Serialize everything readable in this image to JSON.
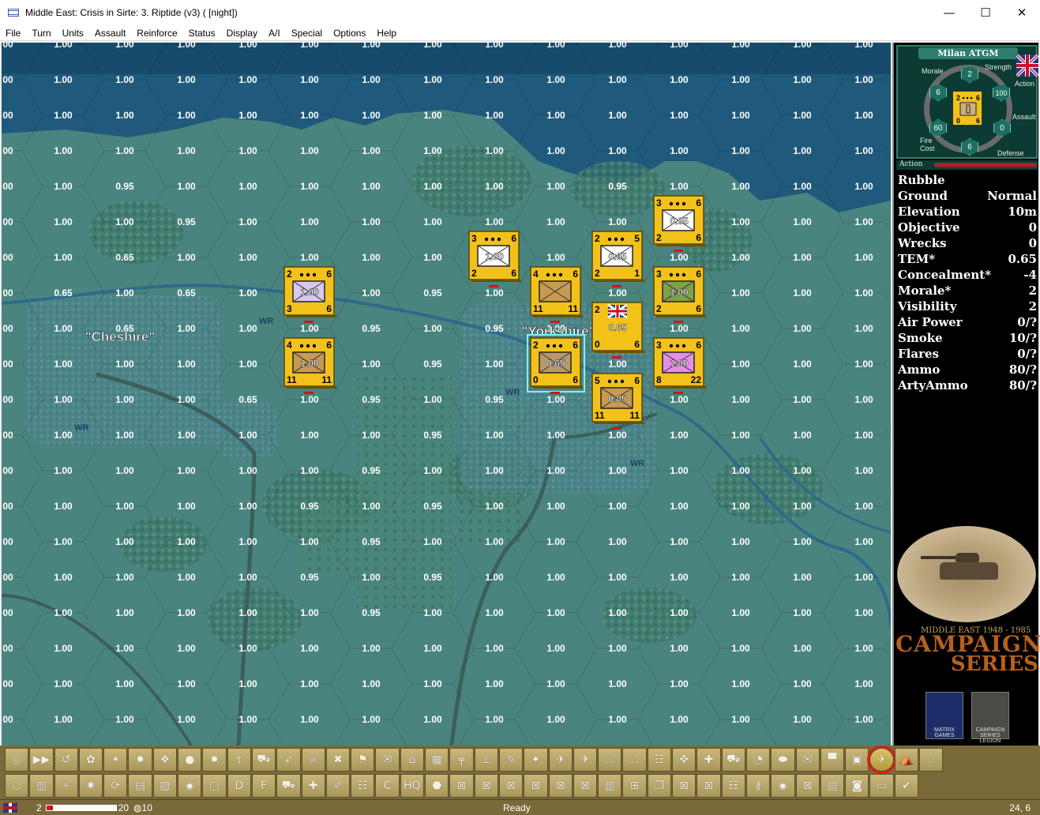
{
  "window": {
    "title": "Middle East: Crisis in Sirte: 3. Riptide (v3) ( [night])",
    "minimize_glyph": "—",
    "maximize_glyph": "☐",
    "close_glyph": "✕"
  },
  "menu": [
    "File",
    "Turn",
    "Units",
    "Assault",
    "Reinforce",
    "Status",
    "Display",
    "A/I",
    "Special",
    "Options",
    "Help"
  ],
  "map": {
    "place_names": [
      {
        "id": "cheshire",
        "label": "\"Cheshire\""
      },
      {
        "id": "yorkshire",
        "label": "\"Yorkshire\""
      }
    ],
    "wr_label": "WR",
    "columns": 15,
    "rows": 20,
    "hex_values": [
      [
        "00",
        "1.00",
        "1.00",
        "1.00",
        "1.00",
        "1.00",
        "1.00",
        "1.00",
        "1.00",
        "1.00",
        "1.00",
        "1.00",
        "1.00",
        "1.00",
        "1.00"
      ],
      [
        "00",
        "1.00",
        "1.00",
        "1.00",
        "1.00",
        "1.00",
        "1.00",
        "1.00",
        "1.00",
        "1.00",
        "1.00",
        "1.00",
        "1.00",
        "1.00",
        "1.00"
      ],
      [
        "00",
        "1.00",
        "1.00",
        "1.00",
        "1.00",
        "1.00",
        "1.00",
        "1.00",
        "1.00",
        "1.00",
        "1.00",
        "1.00",
        "1.00",
        "1.00",
        "1.00"
      ],
      [
        "00",
        "1.00",
        "1.00",
        "1.00",
        "1.00",
        "1.00",
        "1.00",
        "1.00",
        "1.00",
        "1.00",
        "1.00",
        "1.00",
        "1.00",
        "1.00",
        "1.00"
      ],
      [
        "00",
        "1.00",
        "0.95",
        "1.00",
        "1.00",
        "1.00",
        "1.00",
        "1.00",
        "1.00",
        "1.00",
        "0.95",
        "1.00",
        "1.00",
        "1.00",
        "1.00"
      ],
      [
        "00",
        "1.00",
        "1.00",
        "0.95",
        "1.00",
        "1.00",
        "1.00",
        "1.00",
        "1.00",
        "1.00",
        "1.00",
        "0.95",
        "1.00",
        "1.00",
        "1.00"
      ],
      [
        "00",
        "1.00",
        "0.65",
        "1.00",
        "1.00",
        "1.00",
        "1.00",
        "1.00",
        "1.00",
        "1.00",
        "0.65",
        "1.00",
        "1.00",
        "1.00",
        "1.00"
      ],
      [
        "00",
        "0.65",
        "1.00",
        "0.65",
        "1.00",
        "1.00",
        "1.00",
        "0.95",
        "1.00",
        "1.00",
        "1.00",
        "1.00",
        "1.00",
        "1.00",
        "1.00"
      ],
      [
        "00",
        "1.00",
        "0.65",
        "1.00",
        "1.00",
        "1.00",
        "0.95",
        "1.00",
        "0.95",
        "1.00",
        "0.65",
        "1.00",
        "1.00",
        "1.00",
        "1.00"
      ],
      [
        "00",
        "1.00",
        "1.00",
        "1.00",
        "1.00",
        "1.00",
        "1.00",
        "0.95",
        "1.00",
        "0.65",
        "1.00",
        "1.00",
        "1.00",
        "1.00",
        "1.00"
      ],
      [
        "00",
        "1.00",
        "1.00",
        "1.00",
        "0.65",
        "1.00",
        "0.95",
        "1.00",
        "0.95",
        "1.00",
        "0.85",
        "1.00",
        "1.00",
        "1.00",
        "1.00"
      ],
      [
        "00",
        "1.00",
        "1.00",
        "1.00",
        "1.00",
        "1.00",
        "1.00",
        "0.95",
        "1.00",
        "1.00",
        "1.00",
        "1.00",
        "1.00",
        "1.00",
        "1.00"
      ],
      [
        "00",
        "1.00",
        "1.00",
        "1.00",
        "1.00",
        "1.00",
        "0.95",
        "1.00",
        "1.00",
        "1.00",
        "1.00",
        "1.00",
        "1.00",
        "1.00",
        "1.00"
      ],
      [
        "00",
        "1.00",
        "1.00",
        "1.00",
        "1.00",
        "0.95",
        "1.00",
        "0.95",
        "1.00",
        "1.00",
        "1.00",
        "1.00",
        "1.00",
        "1.00",
        "1.00"
      ],
      [
        "00",
        "1.00",
        "1.00",
        "1.00",
        "1.00",
        "1.00",
        "0.95",
        "1.00",
        "1.00",
        "1.00",
        "1.00",
        "1.00",
        "1.00",
        "1.00",
        "1.00"
      ],
      [
        "00",
        "1.00",
        "1.00",
        "1.00",
        "1.00",
        "0.95",
        "1.00",
        "0.95",
        "1.00",
        "1.00",
        "1.00",
        "1.00",
        "1.00",
        "1.00",
        "1.00"
      ],
      [
        "00",
        "1.00",
        "1.00",
        "1.00",
        "1.00",
        "1.00",
        "0.95",
        "1.00",
        "1.00",
        "1.00",
        "1.00",
        "1.00",
        "1.00",
        "1.00",
        "1.00"
      ],
      [
        "00",
        "1.00",
        "1.00",
        "1.00",
        "1.00",
        "1.00",
        "1.00",
        "1.00",
        "1.00",
        "1.00",
        "1.00",
        "1.00",
        "1.00",
        "1.00",
        "1.00"
      ],
      [
        "00",
        "1.00",
        "1.00",
        "1.00",
        "1.00",
        "1.00",
        "1.00",
        "1.00",
        "1.00",
        "1.00",
        "1.00",
        "1.00",
        "1.00",
        "1.00",
        "1.00"
      ],
      [
        "00",
        "1.00",
        "1.00",
        "1.00",
        "1.00",
        "1.00",
        "1.00",
        "1.00",
        "1.00",
        "1.00",
        "1.00",
        "1.00",
        "1.00",
        "1.00",
        "1.00"
      ]
    ],
    "units": [
      {
        "col": 5,
        "row": 7,
        "top_left": "2",
        "bottom_left": "3",
        "bottom_right": "6",
        "top_right": "6",
        "value": "1.00",
        "symbol_color": "#d8c8f0"
      },
      {
        "col": 5,
        "row": 9,
        "top_left": "4",
        "bottom_left": "11",
        "bottom_right": "11",
        "top_right": "6",
        "value": "1.00",
        "symbol_color": "#c79a52"
      },
      {
        "col": 8,
        "row": 6,
        "top_left": "3",
        "bottom_left": "2",
        "bottom_right": "6",
        "top_right": "6",
        "value": "1.00",
        "symbol_color": "#ffffff"
      },
      {
        "col": 9,
        "row": 7,
        "top_left": "4",
        "bottom_left": "11",
        "bottom_right": "11",
        "top_right": "6",
        "value": "",
        "symbol_color": "#c79a52"
      },
      {
        "col": 9,
        "row": 9,
        "top_left": "2",
        "bottom_left": "0",
        "bottom_right": "6",
        "top_right": "6",
        "value": "0.65",
        "symbol_color": "#b89a6a",
        "selected": true
      },
      {
        "col": 10,
        "row": 6,
        "top_left": "2",
        "bottom_left": "2",
        "bottom_right": "1",
        "top_right": "5",
        "value": "0.65",
        "symbol_color": "#ffffff"
      },
      {
        "col": 10,
        "row": 8,
        "top_left": "2",
        "bottom_left": "0",
        "bottom_right": "6",
        "top_right": "",
        "value": "0.65",
        "symbol_color": "#f2c21b",
        "flag": true
      },
      {
        "col": 10,
        "row": 10,
        "top_left": "5",
        "bottom_left": "11",
        "bottom_right": "11",
        "top_right": "6",
        "value": "0.85",
        "symbol_color": "#c79a52"
      },
      {
        "col": 11,
        "row": 5,
        "top_left": "3",
        "bottom_left": "2",
        "bottom_right": "6",
        "top_right": "6",
        "value": "0.95",
        "symbol_color": "#ffffff"
      },
      {
        "col": 11,
        "row": 7,
        "top_left": "3",
        "bottom_left": "2",
        "bottom_right": "6",
        "top_right": "6",
        "value": "1.00",
        "symbol_color": "#7fa04a"
      },
      {
        "col": 11,
        "row": 9,
        "top_left": "3",
        "bottom_left": "8",
        "bottom_right": "22",
        "top_right": "6",
        "value": "1.00",
        "symbol_color": "#e48ee8"
      }
    ]
  },
  "unit_card": {
    "name": "Milan ATGM",
    "labels": {
      "morale": "Morale",
      "strength": "Strength",
      "action": "Action",
      "assault": "Assault",
      "fire_cost": "Fire\nCost",
      "defense": "Defense"
    },
    "values": {
      "strength": "2",
      "morale": "6",
      "action": "100",
      "assault": "0",
      "defense": "6",
      "fire_cost": "60"
    },
    "counter": {
      "top_left": "2",
      "top_right": "6",
      "bottom_left": "0",
      "bottom_right": "6"
    },
    "action_label": "Action",
    "action_level": 1.0
  },
  "terrain": {
    "heading": "Rubble",
    "rows": [
      {
        "label": "Ground",
        "value": "Normal"
      },
      {
        "label": "Elevation",
        "value": "10m"
      },
      {
        "label": "Objective",
        "value": "0"
      },
      {
        "label": "Wrecks",
        "value": "0"
      },
      {
        "label": "TEM*",
        "value": "0.65"
      },
      {
        "label": "Concealment*",
        "value": "-4"
      },
      {
        "label": "Morale*",
        "value": "2"
      },
      {
        "label": "Visibility",
        "value": "2"
      },
      {
        "label": "Air Power",
        "value": "0/?"
      },
      {
        "label": "Smoke",
        "value": "10/?"
      },
      {
        "label": "Flares",
        "value": "0/?"
      },
      {
        "label": "Ammo",
        "value": "80/?"
      },
      {
        "label": "ArtyAmmo",
        "value": "80/?"
      }
    ]
  },
  "logo": {
    "subtitle": "MIDDLE EAST 1948 - 1985",
    "line1": "CAMPAIGN",
    "line2": "SERIES"
  },
  "publishers": [
    "MATRIX GAMES",
    "CAMPAIGN SERIES LEGION"
  ],
  "toolbar": {
    "row1": [
      "crosshair-icon",
      "fast-forward-icon",
      "undo-icon",
      "grenade-icon",
      "mine-icon",
      "bomb-icon",
      "cluster-icon",
      "smoke-icon",
      "blast-icon",
      "soldier-icon",
      "truck-icon",
      "flare-icon",
      "skull-icon",
      "repair-icon",
      "rally-icon",
      "mail-icon",
      "bridge-icon",
      "building-icon",
      "gun-icon",
      "mortar-icon",
      "arty-icon",
      "rocket-icon",
      "heli-icon",
      "plane-icon",
      "unload-icon",
      "load-icon",
      "stack-icon",
      "group-icon",
      "gun2-icon",
      "vehicle-icon",
      "gauge-icon",
      "disc-icon",
      "dig-icon",
      "flag-icon",
      "box-icon",
      "airstrike-icon",
      "mark-icon",
      "star-icon"
    ],
    "row2": [
      "hex-icon",
      "map-icon",
      "zoom-icon",
      "honeycomb-icon",
      "cycle-icon",
      "book-icon",
      "image-icon",
      "circle-icon",
      "box2-icon",
      "letter-d-icon",
      "letter-f-icon",
      "car-icon",
      "tools-icon",
      "pencil-icon",
      "troops-icon",
      "letter-c-icon",
      "hq-icon",
      "network-icon",
      "envelope-x-icon",
      "envelope-flag-icon",
      "envelope-grid-icon",
      "envelope-x2-icon",
      "envelope-a-icon",
      "envelope-b-icon",
      "book2-icon",
      "plus-box-icon",
      "copy-icon",
      "envelope-c-icon",
      "envelope-d-icon",
      "squad-icon",
      "key-icon",
      "coins-icon",
      "envelope-e-icon",
      "ledger-icon",
      "stop-icon",
      "monitor-icon",
      "check-icon"
    ],
    "row1_glyphs": [
      "◎",
      "▶▶",
      "↺",
      "✿",
      "✶",
      "✹",
      "❖",
      "●",
      "✸",
      "☥",
      "⛟",
      "➶",
      "☠",
      "✖",
      "⚑",
      "✉",
      "⌂",
      "▦",
      "╤",
      "⊥",
      "✎",
      "✦",
      "✈",
      "✈",
      "⛶",
      "⛶",
      "☷",
      "✥",
      "✚",
      "⛟",
      "◔",
      "⬬",
      "✉",
      "▀",
      "▣",
      "✈",
      "⛺",
      "☆"
    ],
    "row2_glyphs": [
      "⬡",
      "▥",
      "⌖",
      "✺",
      "⟳",
      "▤",
      "▨",
      "◉",
      "▢",
      "D",
      "F",
      "⛟",
      "✚",
      "✐",
      "☷",
      "C",
      "HQ",
      "⬣",
      "⊠",
      "⊠",
      "⊠",
      "⊠",
      "⊠",
      "⊠",
      "▥",
      "⊞",
      "❐",
      "⊠",
      "⊠",
      "☷",
      "⚷",
      "◉",
      "⊠",
      "▤",
      "◙",
      "▭",
      "✔"
    ],
    "highlighted_index": 35
  },
  "status": {
    "turn": "2",
    "turn_max": "20",
    "turn_progress": 0.1,
    "visibility": "10",
    "message": "Ready",
    "coords": "24, 6"
  }
}
